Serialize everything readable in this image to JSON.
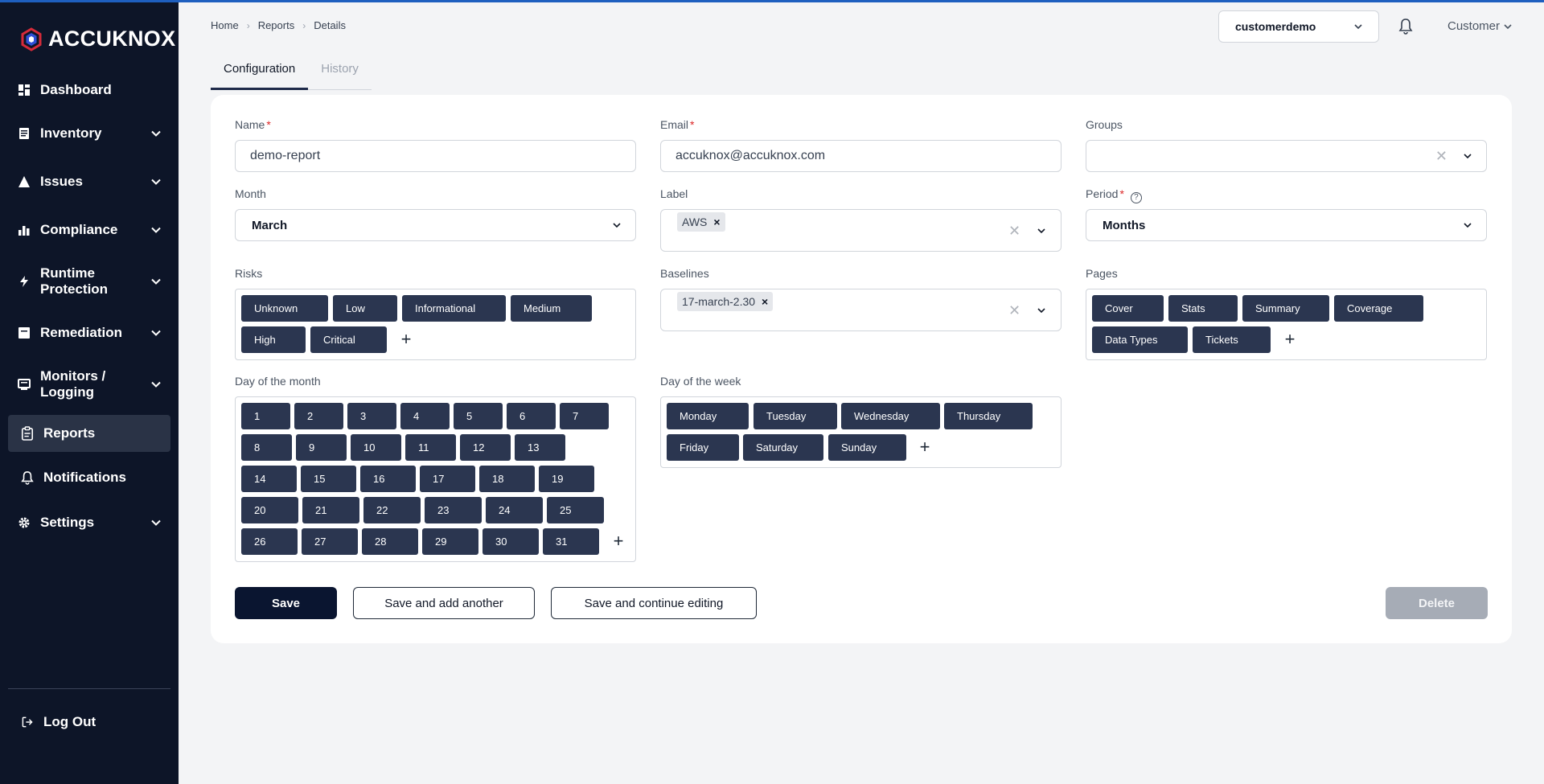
{
  "brand": {
    "name": "ACCUKNOX"
  },
  "sidebar": {
    "items": [
      {
        "label": "Dashboard",
        "icon": "dashboard-icon",
        "has_chevron": false
      },
      {
        "label": "Inventory",
        "icon": "inventory-icon",
        "has_chevron": true
      },
      {
        "label": "Issues",
        "icon": "warning-icon",
        "has_chevron": true
      },
      {
        "label": "Compliance",
        "icon": "bar-chart-icon",
        "has_chevron": true
      },
      {
        "label": "Runtime Protection",
        "icon": "bolt-icon",
        "has_chevron": true
      },
      {
        "label": "Remediation",
        "icon": "remediation-icon",
        "has_chevron": true
      },
      {
        "label": "Monitors / Logging",
        "icon": "monitor-icon",
        "has_chevron": true
      },
      {
        "label": "Reports",
        "icon": "clipboard-icon",
        "has_chevron": false,
        "active": true
      },
      {
        "label": "Notifications",
        "icon": "bell-icon",
        "has_chevron": false
      },
      {
        "label": "Settings",
        "icon": "gear-icon",
        "has_chevron": true
      }
    ],
    "logout_label": "Log Out"
  },
  "header": {
    "breadcrumb": [
      "Home",
      "Reports",
      "Details"
    ],
    "tenant": "customerdemo",
    "user": "Customer"
  },
  "tabs": [
    {
      "label": "Configuration",
      "active": true
    },
    {
      "label": "History",
      "active": false
    }
  ],
  "form": {
    "name": {
      "label": "Name",
      "value": "demo-report",
      "required": true
    },
    "email": {
      "label": "Email",
      "value": "accuknox@accuknox.com",
      "required": true
    },
    "groups": {
      "label": "Groups",
      "value": ""
    },
    "month": {
      "label": "Month",
      "value": "March"
    },
    "label": {
      "label": "Label",
      "tags": [
        "AWS"
      ]
    },
    "period": {
      "label": "Period",
      "value": "Months",
      "required": true
    },
    "risks": {
      "label": "Risks",
      "chips": [
        "Unknown",
        "Low",
        "Informational",
        "Medium",
        "High",
        "Critical"
      ]
    },
    "baselines": {
      "label": "Baselines",
      "tags": [
        "17-march-2.30"
      ]
    },
    "pages": {
      "label": "Pages",
      "chips": [
        "Cover",
        "Stats",
        "Summary",
        "Coverage",
        "Data Types",
        "Tickets"
      ]
    },
    "day_of_month": {
      "label": "Day of the month",
      "chips": [
        "1",
        "2",
        "3",
        "4",
        "5",
        "6",
        "7",
        "8",
        "9",
        "10",
        "11",
        "12",
        "13",
        "14",
        "15",
        "16",
        "17",
        "18",
        "19",
        "20",
        "21",
        "22",
        "23",
        "24",
        "25",
        "26",
        "27",
        "28",
        "29",
        "30",
        "31"
      ]
    },
    "day_of_week": {
      "label": "Day of the week",
      "chips": [
        "Monday",
        "Tuesday",
        "Wednesday",
        "Thursday",
        "Friday",
        "Saturday",
        "Sunday"
      ]
    }
  },
  "actions": {
    "save": "Save",
    "save_add": "Save and add another",
    "save_continue": "Save and continue editing",
    "delete": "Delete"
  },
  "colors": {
    "sidebar_bg": "#0d1528",
    "chip_bg": "#2b3650",
    "primary": "#0a1530",
    "required": "#dc2626"
  }
}
